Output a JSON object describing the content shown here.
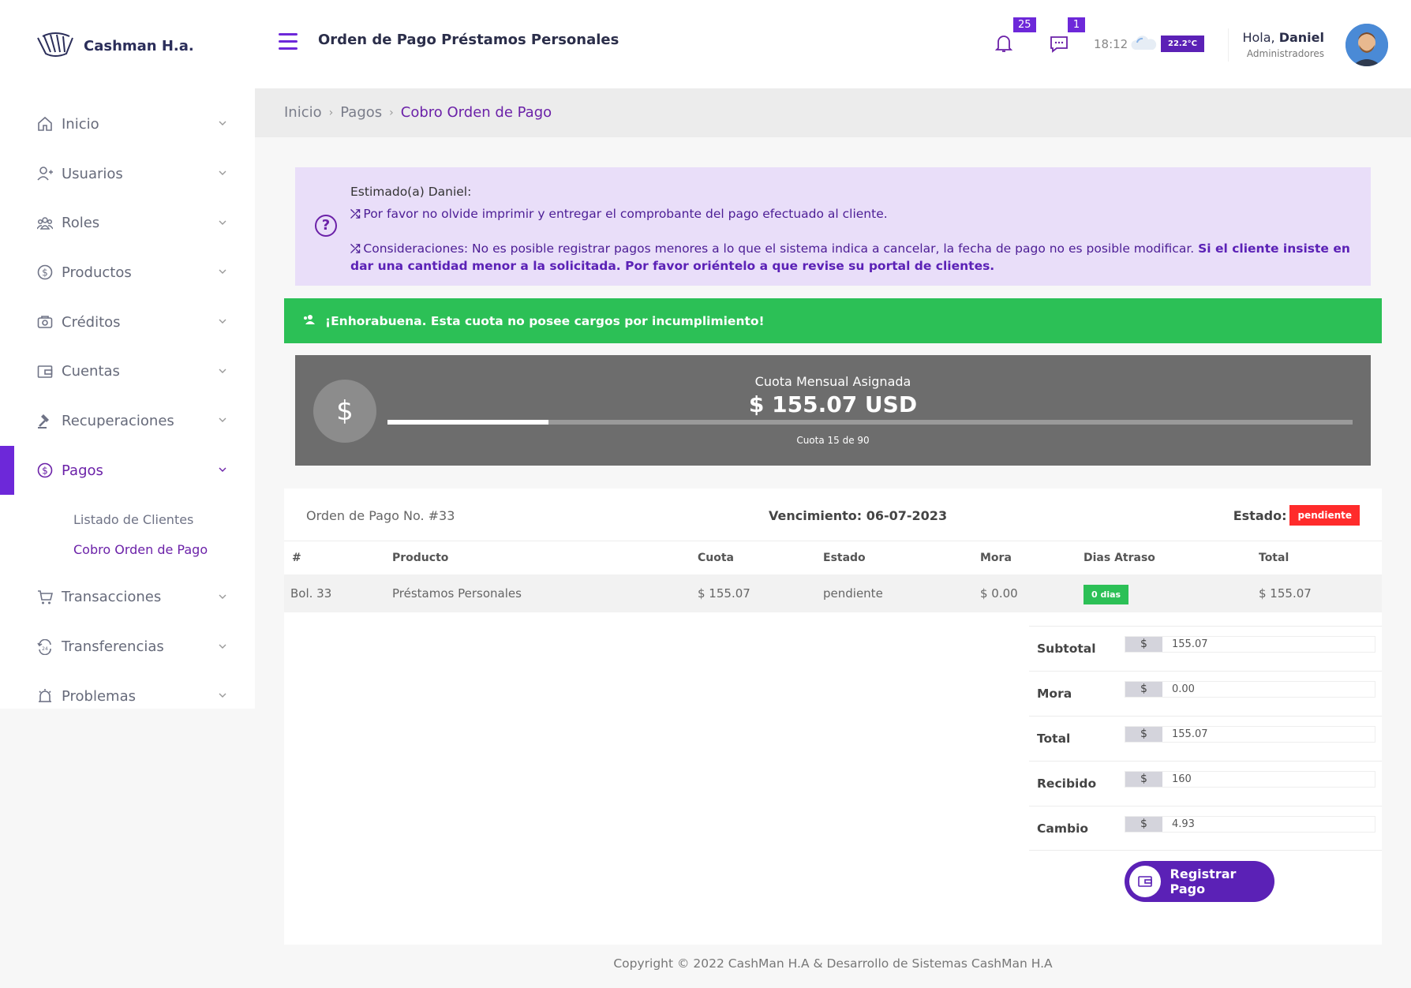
{
  "brand": {
    "name": "Cashman H.a."
  },
  "sidebar": {
    "items": [
      {
        "label": "Inicio",
        "icon": "home-icon"
      },
      {
        "label": "Usuarios",
        "icon": "user-plus-icon"
      },
      {
        "label": "Roles",
        "icon": "users-icon"
      },
      {
        "label": "Productos",
        "icon": "dollar-circle-icon"
      },
      {
        "label": "Créditos",
        "icon": "camera-icon"
      },
      {
        "label": "Cuentas",
        "icon": "wallet-icon"
      },
      {
        "label": "Recuperaciones",
        "icon": "gavel-icon"
      },
      {
        "label": "Pagos",
        "icon": "dollar-circle-icon"
      },
      {
        "label": "Transacciones",
        "icon": "cart-icon"
      },
      {
        "label": "Transferencias",
        "icon": "refresh-24-icon"
      },
      {
        "label": "Problemas",
        "icon": "alarm-icon"
      }
    ],
    "pagos_sub": [
      "Listado de Clientes",
      "Cobro Orden de Pago"
    ]
  },
  "header": {
    "title": "Orden de Pago Préstamos Personales",
    "notifications": "25",
    "messages": "1",
    "time": "18:12",
    "temperature": "22.2°C",
    "greeting": "Hola,",
    "user": "Daniel",
    "role": "Administradores"
  },
  "breadcrumb": {
    "home": "Inicio",
    "section": "Pagos",
    "current": "Cobro Orden de Pago"
  },
  "notice": {
    "salute": "Estimado(a) Daniel:",
    "line1": "Por favor no olvide imprimir y entregar el comprobante del pago efectuado al cliente.",
    "line2": "Consideraciones: No es posible registrar pagos menores a lo que el sistema indica a cancelar, la fecha de pago no es posible modificar.",
    "line2_bold": "Si el cliente insiste en dar una cantidad menor a la solicitada. Por favor oriéntelo a que revise su portal de clientes."
  },
  "success_banner": "¡Enhorabuena. Esta cuota no posee cargos por incumplimiento!",
  "quota": {
    "title": "Cuota Mensual Asignada",
    "amount": "$ 155.07 USD",
    "progress_label": "Cuota 15 de 90",
    "progress_fraction": 0.1667
  },
  "order": {
    "number": "Orden de Pago No. #33",
    "due": "Vencimiento: 06-07-2023",
    "status_label": "Estado:",
    "status": "pendiente",
    "columns": [
      "#",
      "Producto",
      "Cuota",
      "Estado",
      "Mora",
      "Dias Atraso",
      "Total"
    ],
    "row": {
      "id": "Bol. 33",
      "product": "Préstamos Personales",
      "fee": "$ 155.07",
      "status": "pendiente",
      "late_fee": "$ 0.00",
      "days_late": "0 dias",
      "total": "$ 155.07"
    }
  },
  "totals": {
    "currency": "$",
    "subtotal_label": "Subtotal",
    "subtotal": "155.07",
    "mora_label": "Mora",
    "mora": "0.00",
    "total_label": "Total",
    "total": "155.07",
    "received_label": "Recibido",
    "received": "160",
    "change_label": "Cambio",
    "change": "4.93"
  },
  "register_button": "Registrar Pago",
  "footer": "Copyright © 2022 CashMan H.A & Desarrollo de Sistemas CashMan H.A",
  "colors": {
    "accent": "#6d28d9",
    "success": "#2cc056",
    "danger": "#ff2b2b"
  }
}
